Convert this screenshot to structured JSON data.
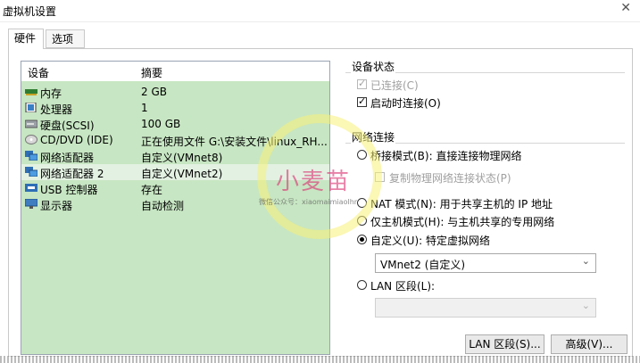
{
  "window": {
    "title": "虚拟机设置"
  },
  "tabs": [
    {
      "label": "硬件"
    },
    {
      "label": "选项"
    }
  ],
  "device_table": {
    "headers": {
      "device": "设备",
      "summary": "摘要"
    },
    "rows": [
      {
        "name": "内存",
        "summary": "2 GB",
        "icon": "memory-icon"
      },
      {
        "name": "处理器",
        "summary": "1",
        "icon": "cpu-icon"
      },
      {
        "name": "硬盘(SCSI)",
        "summary": "100 GB",
        "icon": "harddisk-icon"
      },
      {
        "name": "CD/DVD (IDE)",
        "summary": "正在使用文件 G:\\安装文件\\linux_RH...",
        "icon": "cd-icon"
      },
      {
        "name": "网络适配器",
        "summary": "自定义(VMnet8)",
        "icon": "network-icon"
      },
      {
        "name": "网络适配器 2",
        "summary": "自定义(VMnet2)",
        "icon": "network-icon",
        "selected": true
      },
      {
        "name": "USB 控制器",
        "summary": "存在",
        "icon": "usb-icon"
      },
      {
        "name": "显示器",
        "summary": "自动检测",
        "icon": "monitor-icon"
      }
    ]
  },
  "device_status": {
    "label": "设备状态",
    "connected": {
      "label": "已连接(C)",
      "checked": true,
      "enabled": false
    },
    "connect_on_start": {
      "label": "启动时连接(O)",
      "checked": true,
      "enabled": true
    }
  },
  "network": {
    "label": "网络连接",
    "bridged": {
      "label": "桥接模式(B): 直接连接物理网络"
    },
    "replicate": {
      "label": "复制物理网络连接状态(P)"
    },
    "nat": {
      "label": "NAT 模式(N): 用于共享主机的 IP 地址"
    },
    "host_only": {
      "label": "仅主机模式(H): 与主机共享的专用网络"
    },
    "custom": {
      "label": "自定义(U): 特定虚拟网络",
      "selected": true
    },
    "custom_select_value": "VMnet2 (自定义)",
    "lan_segment": {
      "label": "LAN 区段(L):"
    },
    "lan_select_value": ""
  },
  "buttons": {
    "lan_segments": "LAN 区段(S)...",
    "advanced": "高级(V)..."
  },
  "watermark": {
    "main": "小麦苗",
    "sub": "微信公众号：xiaomaimiaolhr"
  },
  "colors": {
    "device_list_bg": "#c7e6c3",
    "selected_row": "#e3f1e2"
  }
}
